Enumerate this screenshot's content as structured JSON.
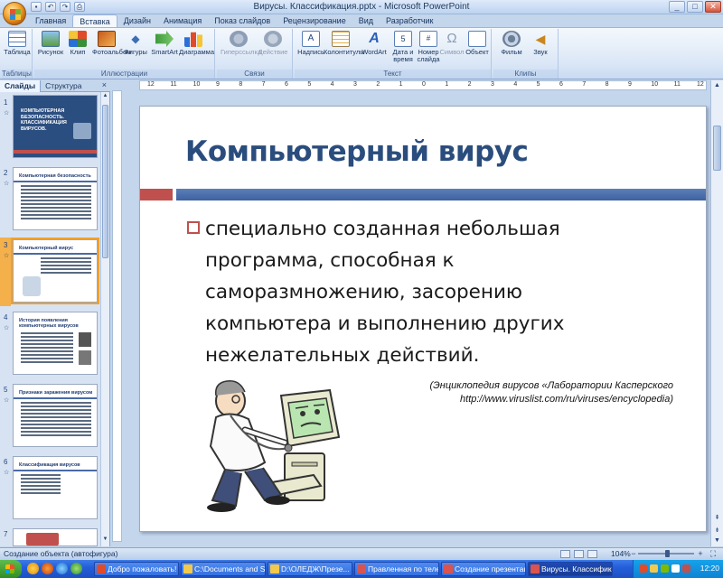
{
  "window": {
    "title": "Вирусы. Классификация.pptx - Microsoft PowerPoint",
    "controls": {
      "minimize": "_",
      "maximize": "□",
      "close": "✕"
    }
  },
  "quick_access": [
    "save-icon",
    "undo-icon",
    "redo-icon",
    "print-icon"
  ],
  "ribbon_tabs": [
    "Главная",
    "Вставка",
    "Дизайн",
    "Анимация",
    "Показ слайдов",
    "Рецензирование",
    "Вид",
    "Разработчик"
  ],
  "ribbon": {
    "groups": [
      {
        "label": "Таблицы",
        "buttons": [
          {
            "label": "Таблица",
            "icon": "table-icon"
          }
        ]
      },
      {
        "label": "Иллюстрации",
        "buttons": [
          {
            "label": "Рисунок",
            "icon": "picture-icon"
          },
          {
            "label": "Клип",
            "icon": "clipart-icon"
          },
          {
            "label": "Фотоальбом",
            "icon": "photo-album-icon"
          },
          {
            "label": "Фигуры",
            "icon": "shapes-icon"
          },
          {
            "label": "SmartArt",
            "icon": "smartart-icon"
          },
          {
            "label": "Диаграмма",
            "icon": "chart-icon"
          }
        ]
      },
      {
        "label": "Связи",
        "buttons": [
          {
            "label": "Гиперссылка",
            "icon": "hyperlink-icon"
          },
          {
            "label": "Действие",
            "icon": "action-icon"
          }
        ]
      },
      {
        "label": "Текст",
        "buttons": [
          {
            "label": "Надпись",
            "icon": "textbox-icon"
          },
          {
            "label": "Колонтитулы",
            "icon": "header-footer-icon"
          },
          {
            "label": "WordArt",
            "icon": "wordart-icon"
          },
          {
            "label": "Дата и время",
            "icon": "datetime-icon"
          },
          {
            "label": "Номер слайда",
            "icon": "slide-number-icon"
          },
          {
            "label": "Символ",
            "icon": "symbol-icon"
          },
          {
            "label": "Объект",
            "icon": "object-icon"
          }
        ]
      },
      {
        "label": "Клипы мультимедиа",
        "buttons": [
          {
            "label": "Фильм",
            "icon": "movie-icon"
          },
          {
            "label": "Звук",
            "icon": "sound-icon"
          }
        ]
      }
    ]
  },
  "left_panel": {
    "tabs": [
      "Слайды",
      "Структура"
    ],
    "close": "×",
    "thumbnails": [
      {
        "num": "1",
        "title": "КОМПЬЮТЕРНАЯ БЕЗОПАСНОСТЬ. КЛАССИФИКАЦИЯ ВИРУСОВ.",
        "style": "title"
      },
      {
        "num": "2",
        "title": "Компьютерная безопасность",
        "style": "text"
      },
      {
        "num": "3",
        "title": "Компьютерный вирус",
        "style": "text"
      },
      {
        "num": "4",
        "title": "История появления компьютерных вирусов",
        "style": "text"
      },
      {
        "num": "5",
        "title": "Признаки заражения вирусом",
        "style": "text"
      },
      {
        "num": "6",
        "title": "Классификация вирусов",
        "style": "text"
      },
      {
        "num": "7",
        "title": "",
        "style": "text"
      }
    ],
    "star": "☆"
  },
  "ruler_marks": [
    "12",
    "11",
    "10",
    "9",
    "8",
    "7",
    "6",
    "5",
    "4",
    "3",
    "2",
    "1",
    "0",
    "1",
    "2",
    "3",
    "4",
    "5",
    "6",
    "7",
    "8",
    "9",
    "10",
    "11",
    "12"
  ],
  "slide": {
    "title": "Компьютерный вирус",
    "bullet": "специально созданная небольшая программа, способная к саморазмножению, засорению компьютера и выполнению других нежелательных действий.",
    "citation_line1": "(Энциклопедия вирусов «Лаборатории Касперского",
    "citation_line2": "http://www.viruslist.com/ru/viruses/encyclopedia)"
  },
  "status": {
    "text": "Создание объекта (автофигура)",
    "zoom": "104%",
    "zoom_fraction": 0.52
  },
  "taskbar": {
    "tasks": [
      {
        "label": "Добро пожаловать!",
        "color": "#e04b2a"
      },
      {
        "label": "C:\\Documents and Se...",
        "color": "#f2c94c"
      },
      {
        "label": "D:\\ОЛЕДЖ\\Презе...",
        "color": "#f2c94c"
      },
      {
        "label": "Правленная по теле...",
        "color": "#d9534f"
      },
      {
        "label": "Создание презентац...",
        "color": "#d9534f"
      },
      {
        "label": "Вирусы. Классифик...",
        "color": "#d9534f",
        "active": true
      }
    ],
    "clock": "12:20"
  }
}
